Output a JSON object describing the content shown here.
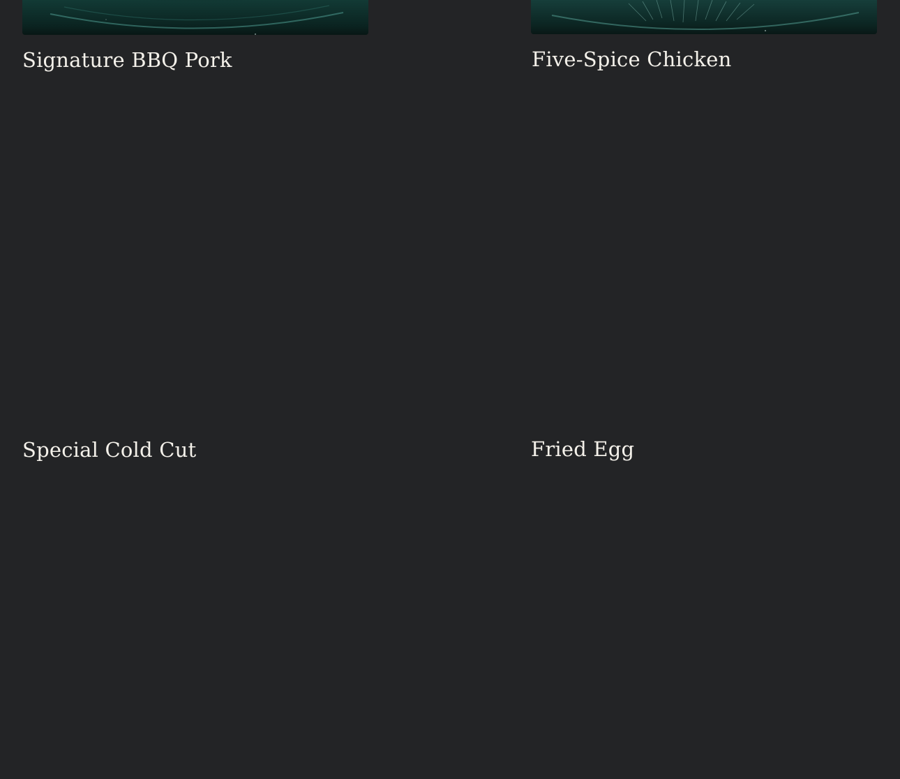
{
  "menu": {
    "items": [
      {
        "name": "Signature BBQ Pork"
      },
      {
        "name": "Five-Spice Chicken"
      },
      {
        "name": "Special Cold Cut"
      },
      {
        "name": "Fried Egg"
      }
    ]
  },
  "colors": {
    "background": "#232426",
    "title_text": "#f4f1ea",
    "photo_plate": "#0f3a36"
  }
}
